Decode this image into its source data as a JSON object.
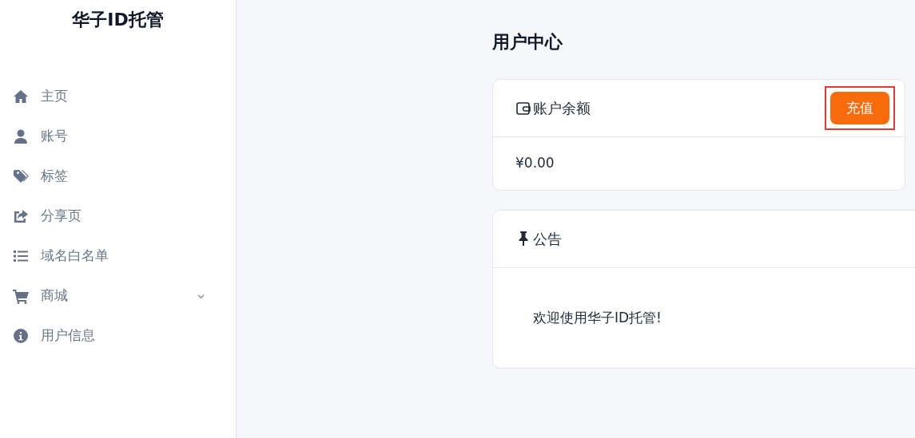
{
  "sidebar": {
    "title": "华子ID托管",
    "items": [
      {
        "label": "主页",
        "expandable": false
      },
      {
        "label": "账号",
        "expandable": false
      },
      {
        "label": "标签",
        "expandable": false
      },
      {
        "label": "分享页",
        "expandable": false
      },
      {
        "label": "域名白名单",
        "expandable": false
      },
      {
        "label": "商城",
        "expandable": true
      },
      {
        "label": "用户信息",
        "expandable": false
      }
    ]
  },
  "page_title": "用户中心",
  "balance_card": {
    "title": "账户余额",
    "button": {
      "label": "充值",
      "highlighted": true
    },
    "amount": "¥0.00"
  },
  "notice_card": {
    "title": "公告",
    "message": "欢迎使用华子ID托管!"
  }
}
